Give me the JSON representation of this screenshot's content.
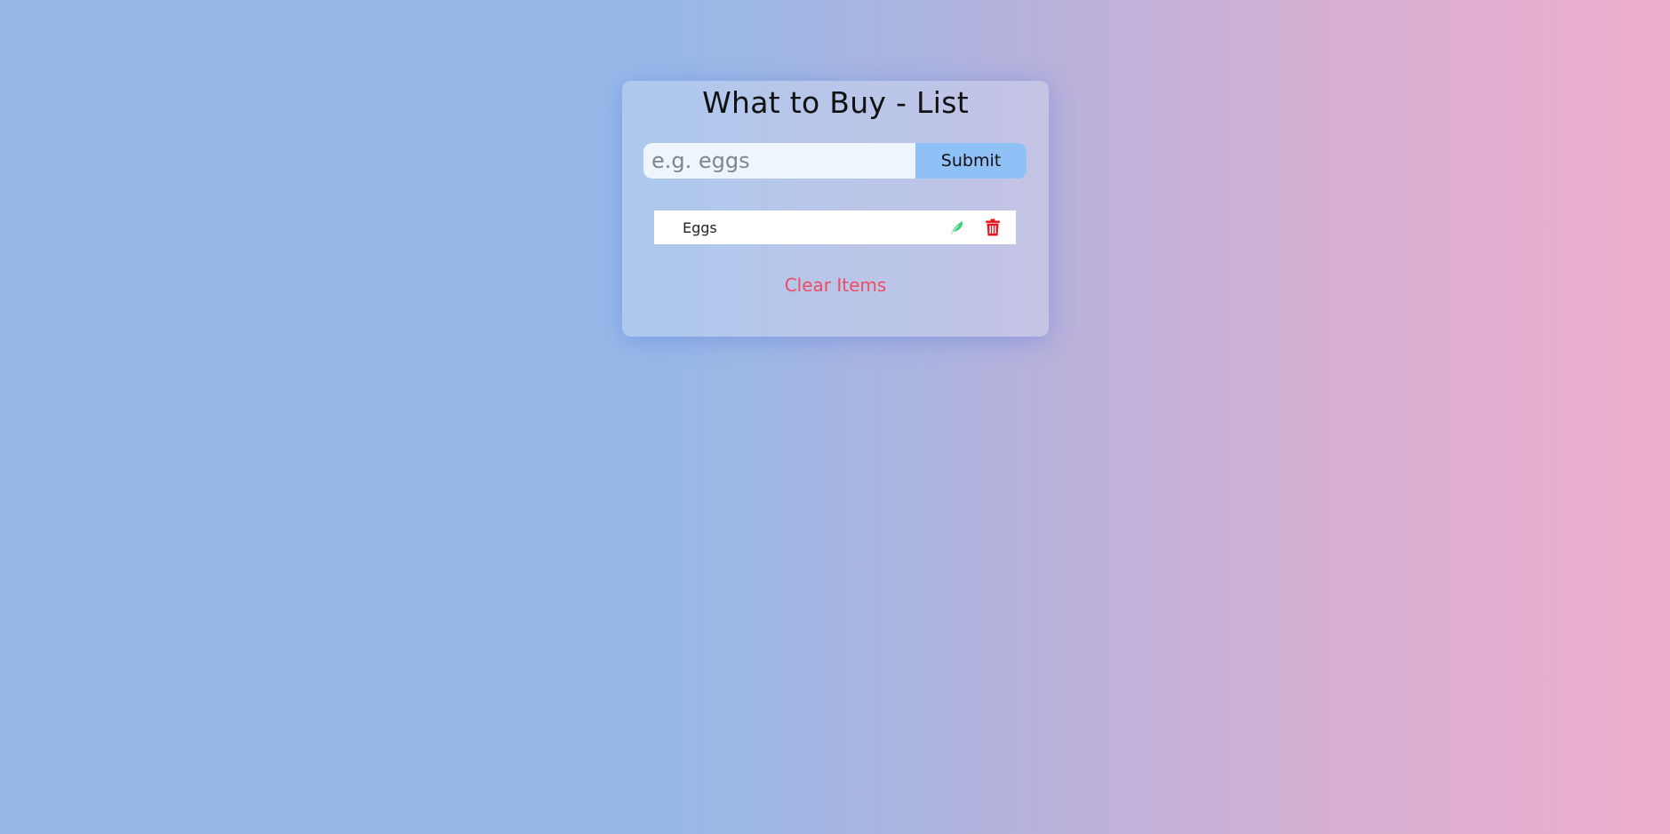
{
  "app": {
    "title": "What to Buy - List"
  },
  "form": {
    "input_placeholder": "e.g. eggs",
    "input_value": "",
    "submit_label": "Submit"
  },
  "items": [
    {
      "label": "Eggs",
      "edit_icon": "feather-edit-icon",
      "delete_icon": "trash-icon"
    }
  ],
  "footer": {
    "clear_label": "Clear Items"
  },
  "colors": {
    "edit_icon": "#3fd27a",
    "delete_icon": "#e8141e",
    "clear_text": "#ef4b63",
    "submit_bg": "#8fc1f7"
  }
}
